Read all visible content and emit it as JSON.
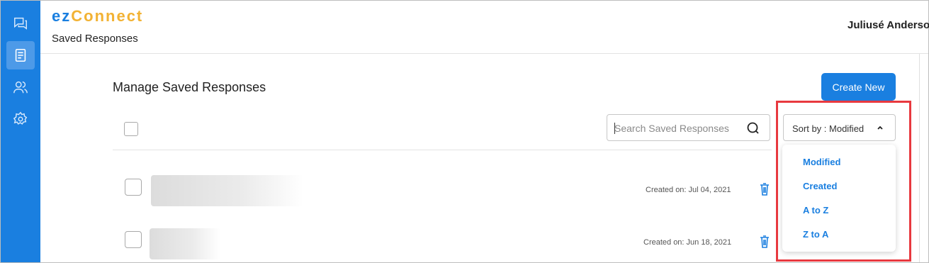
{
  "brand": {
    "part1": "ez",
    "part2": "Connect"
  },
  "header": {
    "section_title": "Saved Responses",
    "user_name": "Juliusé Anderson"
  },
  "sidebar": {
    "items": [
      {
        "icon": "chat-icon",
        "active": false
      },
      {
        "icon": "document-icon",
        "active": true
      },
      {
        "icon": "users-icon",
        "active": false
      },
      {
        "icon": "settings-icon",
        "active": false
      }
    ]
  },
  "main": {
    "title": "Manage Saved Responses",
    "create_label": "Create New",
    "search": {
      "placeholder": "Search Saved Responses"
    },
    "sort": {
      "label": "Sort by : Modified",
      "options": [
        "Modified",
        "Created",
        "A to Z",
        "Z to A"
      ]
    },
    "responses": [
      {
        "created": "Created on: Jul 04, 2021"
      },
      {
        "created": "Created on: Jun 18, 2021"
      }
    ]
  },
  "colors": {
    "accent": "#1a7fe0",
    "brand_secondary": "#f2b233",
    "highlight": "#e8393f"
  }
}
